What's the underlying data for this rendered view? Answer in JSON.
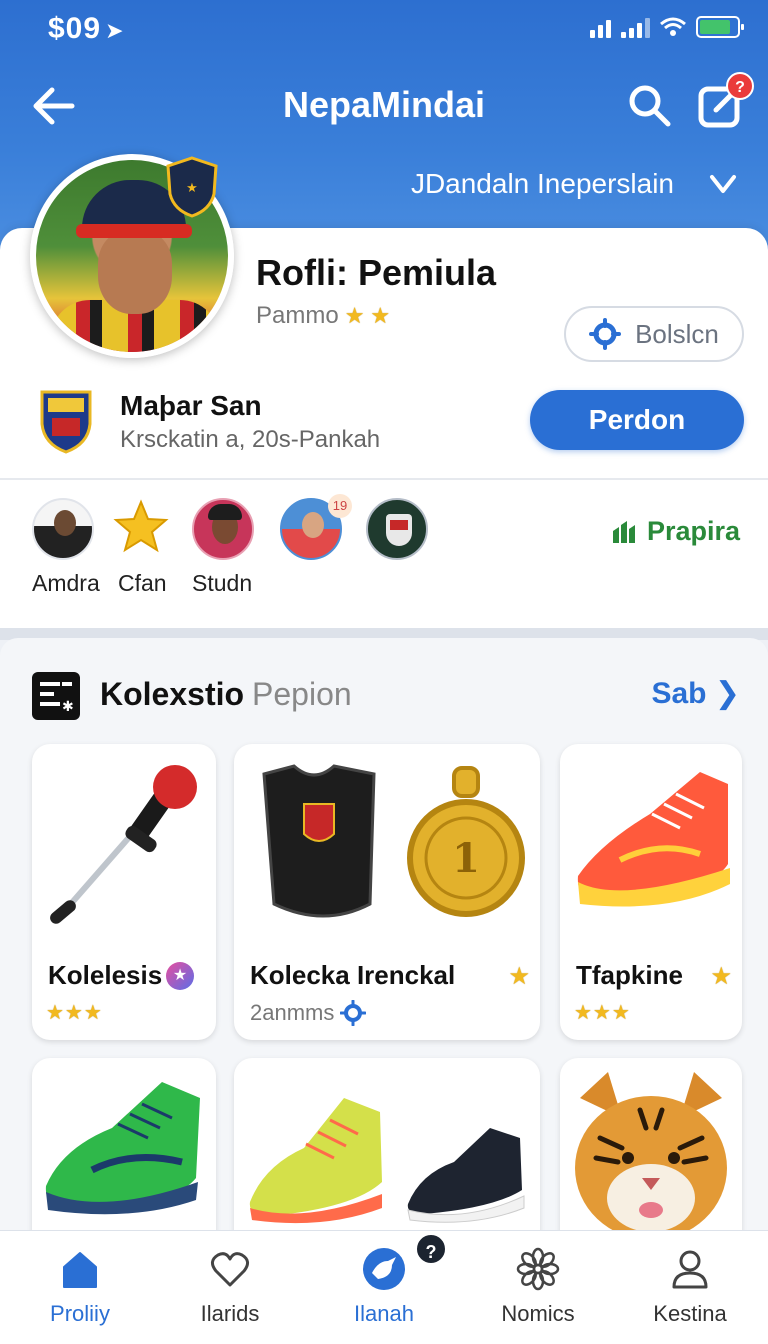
{
  "status": {
    "time": "$09"
  },
  "header": {
    "title": "NepaMindai",
    "notification_count": "?",
    "subtitle": "JDandaln Ineperslain"
  },
  "profile": {
    "name": "Rofli: Pemiula",
    "subtitle": "Pammo",
    "rating_stars": 2,
    "secondary_button": "Bolslcn",
    "club_name": "Maþar San",
    "club_detail": "Krsckatin a, 20s-Pankah",
    "primary_button": "Perdon"
  },
  "followers": {
    "items": [
      {
        "label": "Amdra",
        "icon": "person-avatar"
      },
      {
        "label": "Cfan",
        "icon": "star-icon"
      },
      {
        "label": "Studn",
        "icon": "person-avatar"
      },
      {
        "label": "",
        "icon": "player-avatar",
        "badge": "19"
      },
      {
        "label": "",
        "icon": "club-crest"
      }
    ],
    "link_label": "Prapira"
  },
  "collection": {
    "title": "Kolexstio",
    "title_suffix": "Pepion",
    "see_all": "Sab",
    "cards": [
      {
        "title": "Kolelesis",
        "stars": "★★★",
        "image": "microphone-stand"
      },
      {
        "title": "Kolecka Irenckal",
        "sub": "2anmms",
        "image": "vest-and-medal"
      },
      {
        "title": "Tfapkine",
        "stars": "★★★",
        "image": "orange-sneaker"
      },
      {
        "title": "",
        "image": "green-sneaker"
      },
      {
        "title": "",
        "image": "yellow-and-black-sneakers"
      },
      {
        "title": "",
        "image": "tiger"
      }
    ]
  },
  "bottom_nav": {
    "items": [
      {
        "label": "Proliiy",
        "icon": "home-icon",
        "active": true
      },
      {
        "label": "Ilarids",
        "icon": "heart-icon",
        "active": false
      },
      {
        "label": "Ilanah",
        "icon": "bird-icon",
        "active": true
      },
      {
        "label": "Nomics",
        "icon": "flower-icon",
        "active": false
      },
      {
        "label": "Kestina",
        "icon": "user-icon",
        "active": false
      }
    ],
    "badge": "?"
  },
  "colors": {
    "header_blue": "#2d6fd0",
    "primary": "#2a6fd4",
    "accent_green": "#2a8a3a",
    "star": "#f2b91f",
    "badge_red": "#ea3b3b"
  }
}
